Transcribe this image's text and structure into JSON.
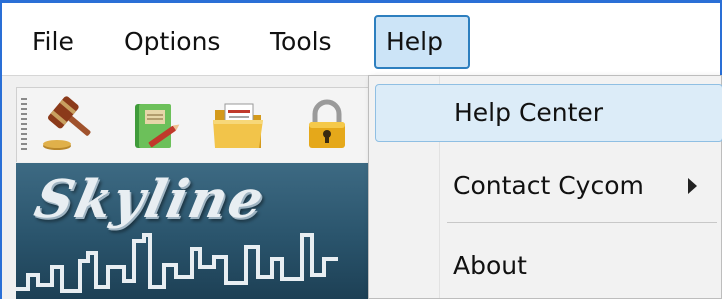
{
  "menubar": {
    "items": [
      {
        "label": "File"
      },
      {
        "label": "Options"
      },
      {
        "label": "Tools"
      },
      {
        "label": "Help",
        "state": "open"
      }
    ]
  },
  "toolbar": {
    "buttons": [
      {
        "icon": "gavel-icon"
      },
      {
        "icon": "book-icon"
      },
      {
        "icon": "folder-icon"
      },
      {
        "icon": "lock-icon"
      }
    ]
  },
  "banner": {
    "title": "Skyline"
  },
  "help_menu": {
    "items": [
      {
        "label": "Help Center",
        "state": "hovered"
      },
      {
        "label": "Contact Cycom",
        "has_submenu": true,
        "submenu_icon": "chevron-right-icon"
      },
      {
        "label": "About"
      }
    ]
  },
  "colors": {
    "window_border": "#2a6fd6",
    "menu_open_bg": "#cce4f7",
    "menu_open_border": "#2d7fbf",
    "hover_bg": "#dcecf8",
    "banner_bg": "#2a546c"
  }
}
